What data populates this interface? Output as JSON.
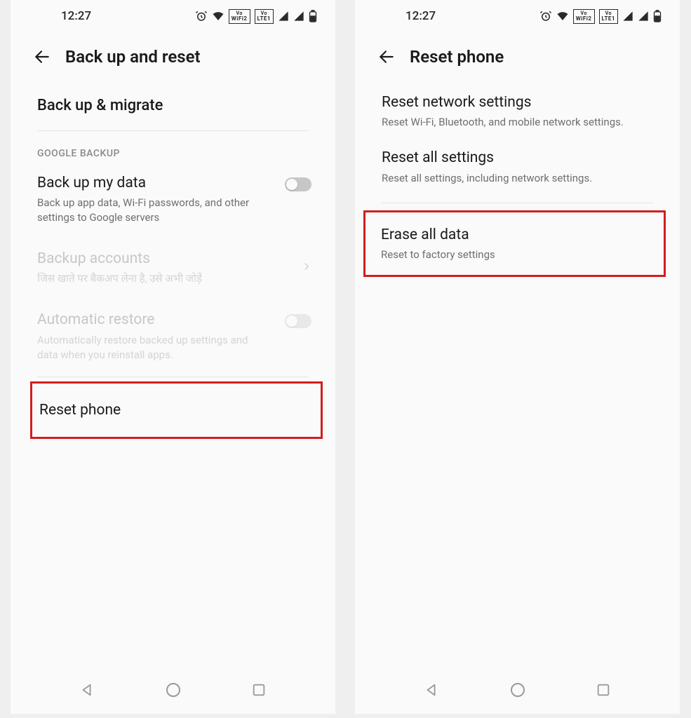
{
  "statusbar": {
    "time": "12:27",
    "wifi_badge_top": "Vo",
    "wifi_badge_bot": "WiFi2",
    "lte_badge_top": "Vo",
    "lte_badge_bot": "LTE1"
  },
  "left": {
    "title": "Back up and reset",
    "backup_migrate": "Back up & migrate",
    "section_google": "GOOGLE BACKUP",
    "backup_data_title": "Back up my data",
    "backup_data_sub": "Back up app data, Wi-Fi passwords, and other settings to Google servers",
    "backup_accounts_title": "Backup accounts",
    "backup_accounts_sub": "जिस खाते पर बैकअप लेना है, उसे अभी जोड़ें",
    "auto_restore_title": "Automatic restore",
    "auto_restore_sub": "Automatically restore backed up settings and data when you reinstall apps.",
    "reset_phone": "Reset phone"
  },
  "right": {
    "title": "Reset phone",
    "reset_network_title": "Reset network settings",
    "reset_network_sub": "Reset Wi-Fi, Bluetooth, and mobile network settings.",
    "reset_all_title": "Reset all settings",
    "reset_all_sub": "Reset all settings, including network settings.",
    "erase_title": "Erase all data",
    "erase_sub": "Reset to factory settings"
  }
}
